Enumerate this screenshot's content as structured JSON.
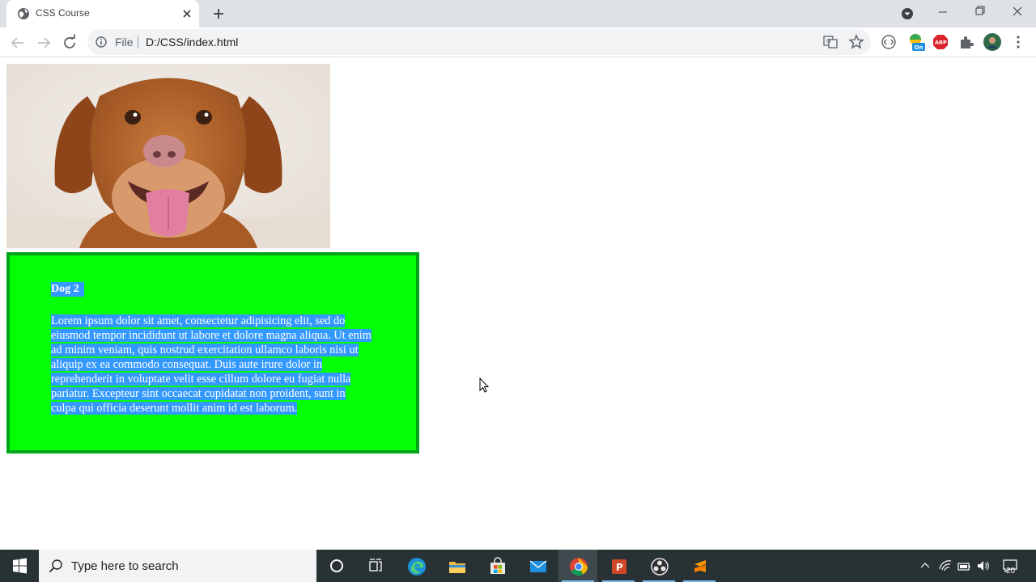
{
  "browser": {
    "tab_title": "CSS Course",
    "address": {
      "scheme_label": "File",
      "url": "D:/CSS/index.html"
    }
  },
  "page": {
    "card": {
      "title": "Dog 2",
      "paragraph": "Lorem ipsum dolor sit amet, consectetur adipisicing elit, sed do eiusmod tempor incididunt ut labore et dolore magna aliqua. Ut enim ad minim veniam, quis nostrud exercitation ullamco laboris nisi ut aliquip ex ea commodo consequat. Duis aute irure dolor in reprehenderit in voluptate velit esse cillum dolore eu fugiat nulla pariatur. Excepteur sint occaecat cupidatat non proident, sunt in culpa qui officia deserunt mollit anim id est laborum.",
      "background_color": "#05ff05",
      "border_color": "#03a41c",
      "selection_color": "#3399ff"
    }
  },
  "taskbar": {
    "search_placeholder": "Type here to search",
    "notification_count": "20",
    "apps": [
      "cortana-icon",
      "task-view-icon",
      "edge-icon",
      "file-explorer-icon",
      "store-icon",
      "mail-icon",
      "chrome-icon",
      "powerpoint-icon",
      "obs-icon",
      "sublime-text-icon"
    ]
  }
}
